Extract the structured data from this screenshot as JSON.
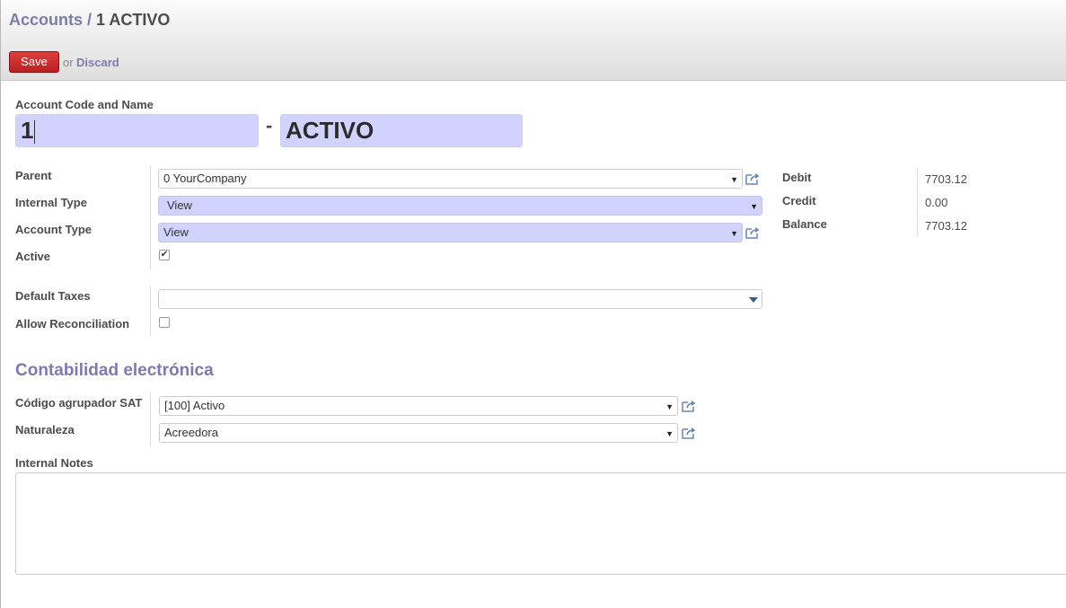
{
  "breadcrumb": {
    "parent": "Accounts",
    "separator": "/",
    "current": "1 ACTIVO"
  },
  "buttons": {
    "save": "Save",
    "or": "or",
    "discard": "Discard"
  },
  "header": {
    "label": "Account Code and Name",
    "code": "1",
    "dash": "-",
    "name": "ACTIVO"
  },
  "fields": {
    "parent": {
      "label": "Parent",
      "value": "0 YourCompany"
    },
    "internal_type": {
      "label": "Internal Type",
      "value": "View"
    },
    "account_type": {
      "label": "Account Type",
      "value": "View"
    },
    "active": {
      "label": "Active",
      "checked": true
    },
    "default_taxes": {
      "label": "Default Taxes",
      "value": ""
    },
    "allow_reconciliation": {
      "label": "Allow Reconciliation",
      "checked": false
    }
  },
  "totals": {
    "debit": {
      "label": "Debit",
      "value": "7703.12"
    },
    "credit": {
      "label": "Credit",
      "value": "0.00"
    },
    "balance": {
      "label": "Balance",
      "value": "7703.12"
    }
  },
  "electronic": {
    "title": "Contabilidad electrónica",
    "sat_code": {
      "label": "Código agrupador SAT",
      "value": "[100] Activo"
    },
    "nature": {
      "label": "Naturaleza",
      "value": "Acreedora"
    }
  },
  "notes": {
    "label": "Internal Notes",
    "value": ""
  },
  "colors": {
    "accent": "#7c7bad",
    "required_bg": "#d2d2ff",
    "save_button": "#c9302c"
  },
  "icons": {
    "external_link": "external-link-icon",
    "dropdown": "caret-down-icon",
    "check": "check-icon"
  }
}
